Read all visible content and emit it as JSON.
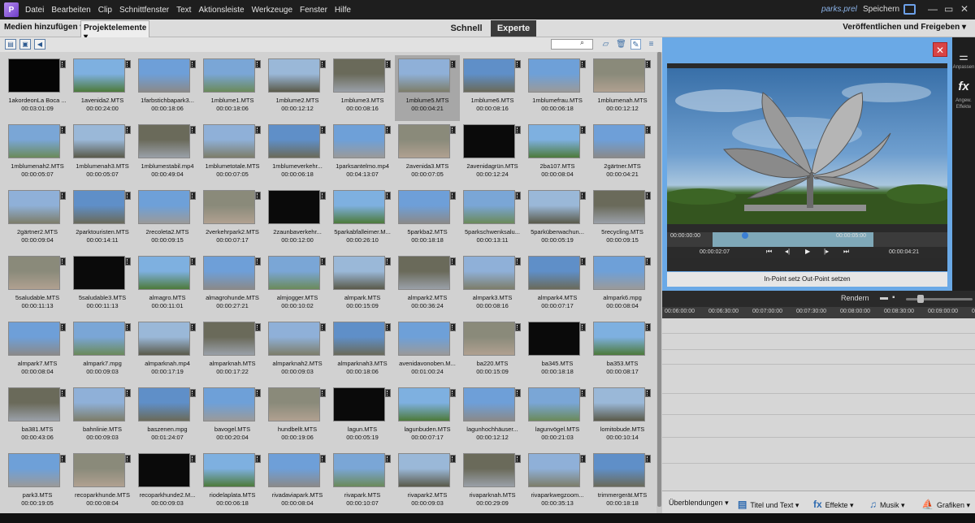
{
  "menu": {
    "logo": "P",
    "items": [
      "Datei",
      "Bearbeiten",
      "Clip",
      "Schnittfenster",
      "Text",
      "Aktionsleiste",
      "Werkzeuge",
      "Fenster",
      "Hilfe"
    ],
    "project_name": "parks.prel",
    "save_label": "Speichern"
  },
  "toolbar": {
    "add_media": "Medien hinzufügen",
    "project_assets": "Projektelemente",
    "mode_quick": "Schnell",
    "mode_expert": "Experte",
    "share": "Veröffentlichen und Freigeben"
  },
  "media": {
    "items": [
      {
        "name": "1akordeonLa Boca ...",
        "duration": "00:03:01:09"
      },
      {
        "name": "1avenida2.MTS",
        "duration": "00:00:24:00"
      },
      {
        "name": "1farbstichbapark3...",
        "duration": "00:00:18:06"
      },
      {
        "name": "1mblume1.MTS",
        "duration": "00:00:18:06"
      },
      {
        "name": "1mblume2.MTS",
        "duration": "00:00:12:12"
      },
      {
        "name": "1mblume3.MTS",
        "duration": "00:00:08:16"
      },
      {
        "name": "1mblume5.MTS",
        "duration": "00:00:04:21"
      },
      {
        "name": "1mblume6.MTS",
        "duration": "00:00:08:16"
      },
      {
        "name": "1mblumefrau.MTS",
        "duration": "00:00:06:18"
      },
      {
        "name": "1mblumenah.MTS",
        "duration": "00:00:12:12"
      },
      {
        "name": "1mblumenah2.MTS",
        "duration": "00:00:05:07"
      },
      {
        "name": "1mblumenah3.MTS",
        "duration": "00:00:05:07"
      },
      {
        "name": "1mblumestabil.mp4",
        "duration": "00:00:49:04"
      },
      {
        "name": "1mblumetotale.MTS",
        "duration": "00:00:07:05"
      },
      {
        "name": "1mblumeverkehr...",
        "duration": "00:00:06:18"
      },
      {
        "name": "1parksantelmo.mp4",
        "duration": "00:04:13:07"
      },
      {
        "name": "2avenida3.MTS",
        "duration": "00:00:07:05"
      },
      {
        "name": "2avenidagrün.MTS",
        "duration": "00:00:12:24"
      },
      {
        "name": "2ba107.MTS",
        "duration": "00:00:08:04"
      },
      {
        "name": "2gärtner.MTS",
        "duration": "00:00:04:21"
      },
      {
        "name": "2gärtner2.MTS",
        "duration": "00:00:09:04"
      },
      {
        "name": "2parktouristen.MTS",
        "duration": "00:00:14:11"
      },
      {
        "name": "2recoleta2.MTS",
        "duration": "00:00:09:15"
      },
      {
        "name": "2verkehrpark2.MTS",
        "duration": "00:00:07:17"
      },
      {
        "name": "2zaunbaverkehr...",
        "duration": "00:00:12:00"
      },
      {
        "name": "5parkabfalleimer.M...",
        "duration": "00:00:26:10"
      },
      {
        "name": "5parkba2.MTS",
        "duration": "00:00:18:18"
      },
      {
        "name": "5parkschwenksalu...",
        "duration": "00:00:13:11"
      },
      {
        "name": "5parküberwachun...",
        "duration": "00:00:05:19"
      },
      {
        "name": "5recycling.MTS",
        "duration": "00:00:09:15"
      },
      {
        "name": "5saludable.MTS",
        "duration": "00:00:11:13"
      },
      {
        "name": "5saludable3.MTS",
        "duration": "00:00:11:13"
      },
      {
        "name": "almagro.MTS",
        "duration": "00:00:11:01"
      },
      {
        "name": "almagrohunde.MTS",
        "duration": "00:00:27:21"
      },
      {
        "name": "almjogger.MTS",
        "duration": "00:00:10:02"
      },
      {
        "name": "almpark.MTS",
        "duration": "00:00:15:09"
      },
      {
        "name": "almpark2.MTS",
        "duration": "00:00:36:24"
      },
      {
        "name": "almpark3.MTS",
        "duration": "00:00:08:16"
      },
      {
        "name": "almpark4.MTS",
        "duration": "00:00:07:17"
      },
      {
        "name": "almpark6.mpg",
        "duration": "00:00:08:04"
      },
      {
        "name": "almpark7.MTS",
        "duration": "00:00:08:04"
      },
      {
        "name": "almpark7.mpg",
        "duration": "00:00:09:03"
      },
      {
        "name": "almparknah.mp4",
        "duration": "00:00:17:19"
      },
      {
        "name": "almparknah.MTS",
        "duration": "00:00:17:22"
      },
      {
        "name": "almparknah2.MTS",
        "duration": "00:00:09:03"
      },
      {
        "name": "almparknah3.MTS",
        "duration": "00:00:18:06"
      },
      {
        "name": "avenidavonoben.M...",
        "duration": "00:01:00:24"
      },
      {
        "name": "ba220.MTS",
        "duration": "00:00:15:09"
      },
      {
        "name": "ba345.MTS",
        "duration": "00:00:18:18"
      },
      {
        "name": "ba353.MTS",
        "duration": "00:00:08:17"
      },
      {
        "name": "ba381.MTS",
        "duration": "00:00:43:06"
      },
      {
        "name": "bahnlinie.MTS",
        "duration": "00:00:09:03"
      },
      {
        "name": "baszenen.mpg",
        "duration": "00:01:24:07"
      },
      {
        "name": "bavogel.MTS",
        "duration": "00:00:20:04"
      },
      {
        "name": "hundbellt.MTS",
        "duration": "00:00:19:06"
      },
      {
        "name": "lagun.MTS",
        "duration": "00:00:05:19"
      },
      {
        "name": "lagunbuden.MTS",
        "duration": "00:00:07:17"
      },
      {
        "name": "lagunhochhäuser...",
        "duration": "00:00:12:12"
      },
      {
        "name": "lagunvögel.MTS",
        "duration": "00:00:21:03"
      },
      {
        "name": "lomitobude.MTS",
        "duration": "00:00:10:14"
      },
      {
        "name": "park3.MTS",
        "duration": "00:00:19:05"
      },
      {
        "name": "recoparkhunde.MTS",
        "duration": "00:00:08:04"
      },
      {
        "name": "recoparkhunde2.M...",
        "duration": "00:00:09:03"
      },
      {
        "name": "riodelaplata.MTS",
        "duration": "00:00:06:18"
      },
      {
        "name": "rivadaviapark.MTS",
        "duration": "00:00:08:04"
      },
      {
        "name": "rivapark.MTS",
        "duration": "00:00:10:07"
      },
      {
        "name": "rivapark2.MTS",
        "duration": "00:00:09:03"
      },
      {
        "name": "rivaparknah.MTS",
        "duration": "00:00:29:09"
      },
      {
        "name": "rivaparkwegzoom...",
        "duration": "00:00:35:13"
      },
      {
        "name": "trimmergerät.MTS",
        "duration": "00:00:18:18"
      }
    ]
  },
  "preview": {
    "tc_in": "00:00:00:00",
    "tc_out": "00:00:05:00",
    "tc_current": "00:00:02:07",
    "tc_duration": "00:00:04:21",
    "in_out_label": "In-Point setz    Out-Point setzen"
  },
  "rail": {
    "adjust": "Anpassen",
    "effects": "Angew. Effekte"
  },
  "timeline": {
    "render": "Rendern",
    "ruler": [
      "00:06:00:00",
      "00:06:30:00",
      "00:07:00:00",
      "00:07:30:00",
      "00:08:00:00",
      "00:08:30:00",
      "00:09:00:00",
      "00:09:"
    ]
  },
  "bottom": {
    "transitions": "Überblendungen",
    "titles": "Titel und Text",
    "effects": "Effekte",
    "music": "Musik",
    "graphics": "Grafiken"
  }
}
